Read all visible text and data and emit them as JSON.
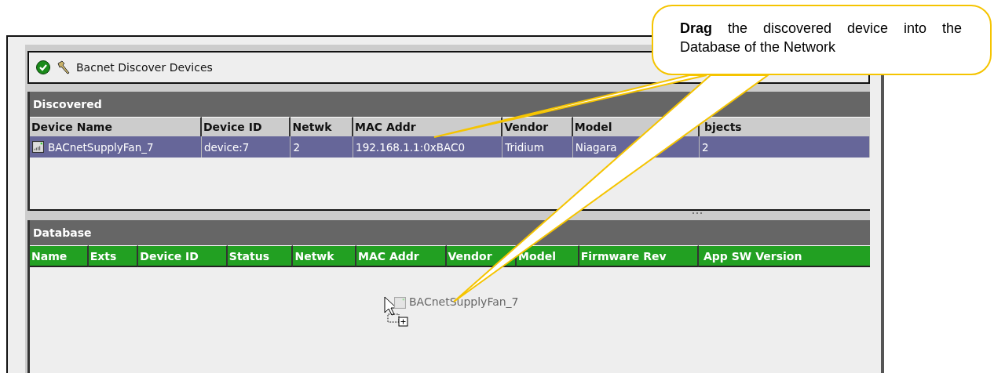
{
  "callout": {
    "text": "**Drag** the discovered device into the Database of the Network"
  },
  "toolbar": {
    "title": "Bacnet Discover Devices"
  },
  "discovered": {
    "title": "Discovered",
    "columns": [
      "Device Name",
      "Device ID",
      "Netwk",
      "MAC Addr",
      "Vendor",
      "Model",
      "bjects"
    ],
    "rows": [
      {
        "selected": true,
        "cells": [
          "BACnetSupplyFan_7",
          "device:7",
          "2",
          "192.168.1.1:0xBAC0",
          "Tridium",
          "Niagara",
          "2"
        ]
      }
    ]
  },
  "database": {
    "title": "Database",
    "columns": [
      "Name",
      "Exts",
      "Device ID",
      "Status",
      "Netwk",
      "MAC Addr",
      "Vendor",
      "Model",
      "Firmware Rev",
      "App SW Version"
    ],
    "drag_item": {
      "label": "BACnetSupplyFan_7"
    }
  }
}
